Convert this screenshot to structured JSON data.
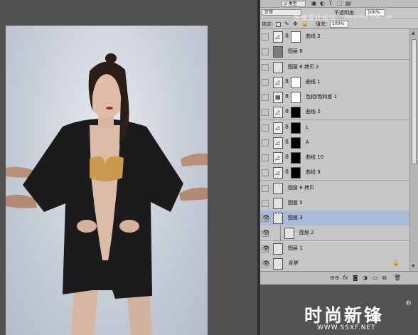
{
  "filter_bar": {
    "kind_label": "ρ 类型"
  },
  "blend_bar": {
    "mode": "正常",
    "opacity_label": "不透明度:",
    "opacity_value": "100%"
  },
  "lock_bar": {
    "lock_label": "锁定:",
    "fill_label": "填充:",
    "fill_value": "100%"
  },
  "layers": [
    {
      "name": "曲线 2",
      "visible": false,
      "thumb": "adj",
      "mask": "white",
      "selected": false
    },
    {
      "name": "图层 6",
      "visible": false,
      "thumb": "gray",
      "mask": null,
      "selected": false
    },
    {
      "name": "图层 6 拷贝 2",
      "visible": false,
      "thumb": "photo",
      "mask": null,
      "selected": false
    },
    {
      "name": "曲线 1",
      "visible": false,
      "thumb": "adj",
      "mask": "white",
      "selected": false
    },
    {
      "name": "色相/饱和度 1",
      "visible": false,
      "thumb": "adj",
      "mask": "white",
      "selected": false
    },
    {
      "name": "曲线 5",
      "visible": false,
      "thumb": "adj",
      "mask": "black",
      "selected": false
    },
    {
      "name": "L",
      "visible": false,
      "thumb": "adj",
      "mask": "black",
      "selected": false
    },
    {
      "name": "A",
      "visible": false,
      "thumb": "adj",
      "mask": "black",
      "selected": false
    },
    {
      "name": "曲线 10",
      "visible": false,
      "thumb": "adj",
      "mask": "black",
      "selected": false
    },
    {
      "name": "曲线 9",
      "visible": false,
      "thumb": "adj",
      "mask": "black",
      "selected": false
    },
    {
      "name": "图层 6 拷贝",
      "visible": false,
      "thumb": "photo",
      "mask": null,
      "selected": false
    },
    {
      "name": "图层 5",
      "visible": false,
      "thumb": "photo",
      "mask": null,
      "selected": false
    },
    {
      "name": "图层 3",
      "visible": true,
      "thumb": "transparent",
      "mask": null,
      "selected": true
    },
    {
      "name": "图层 2",
      "visible": true,
      "thumb": "transparent",
      "mask": null,
      "selected": false
    },
    {
      "name": "图层 1",
      "visible": true,
      "thumb": "photo",
      "mask": null,
      "selected": false
    },
    {
      "name": "背景",
      "visible": true,
      "thumb": "photo",
      "mask": null,
      "selected": false,
      "locked": true
    }
  ],
  "watermark": {
    "top_text": "思缘设计论坛",
    "top_url": "WWW.MISSYUAN.COM",
    "brand": "时尚新锋",
    "reg": "®",
    "url": "WWW.SSXF.NET"
  },
  "icons": {
    "eye": "👁",
    "link": "8",
    "lock": "🔒",
    "curves": "◿",
    "huesat": "▦"
  }
}
